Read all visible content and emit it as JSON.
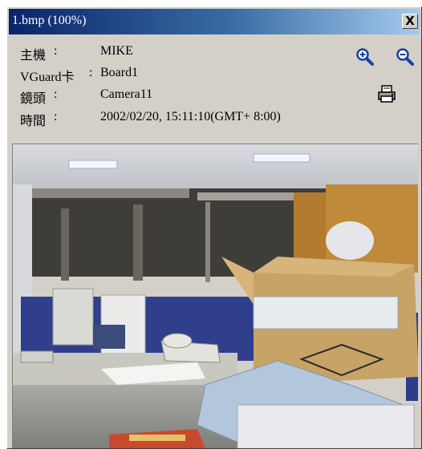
{
  "window": {
    "title": "1.bmp (100%)",
    "close_label": "X"
  },
  "info": {
    "host_label": "主機",
    "host_value": "MIKE",
    "card_label": "VGuard卡",
    "card_value": "Board1",
    "lens_label": "鏡頭",
    "lens_value": "Camera11",
    "time_label": "時間",
    "time_value": "2002/02/20, 15:11:10(GMT+ 8:00)"
  },
  "toolbar": {
    "zoom_in_icon": "zoom-in-icon",
    "zoom_out_icon": "zoom-out-icon",
    "print_icon": "printer-icon"
  },
  "colors": {
    "title_start": "#0a246a",
    "title_end": "#a6caf0",
    "window_bg": "#d4d0c8",
    "icon_blue": "#1a3fa0"
  }
}
